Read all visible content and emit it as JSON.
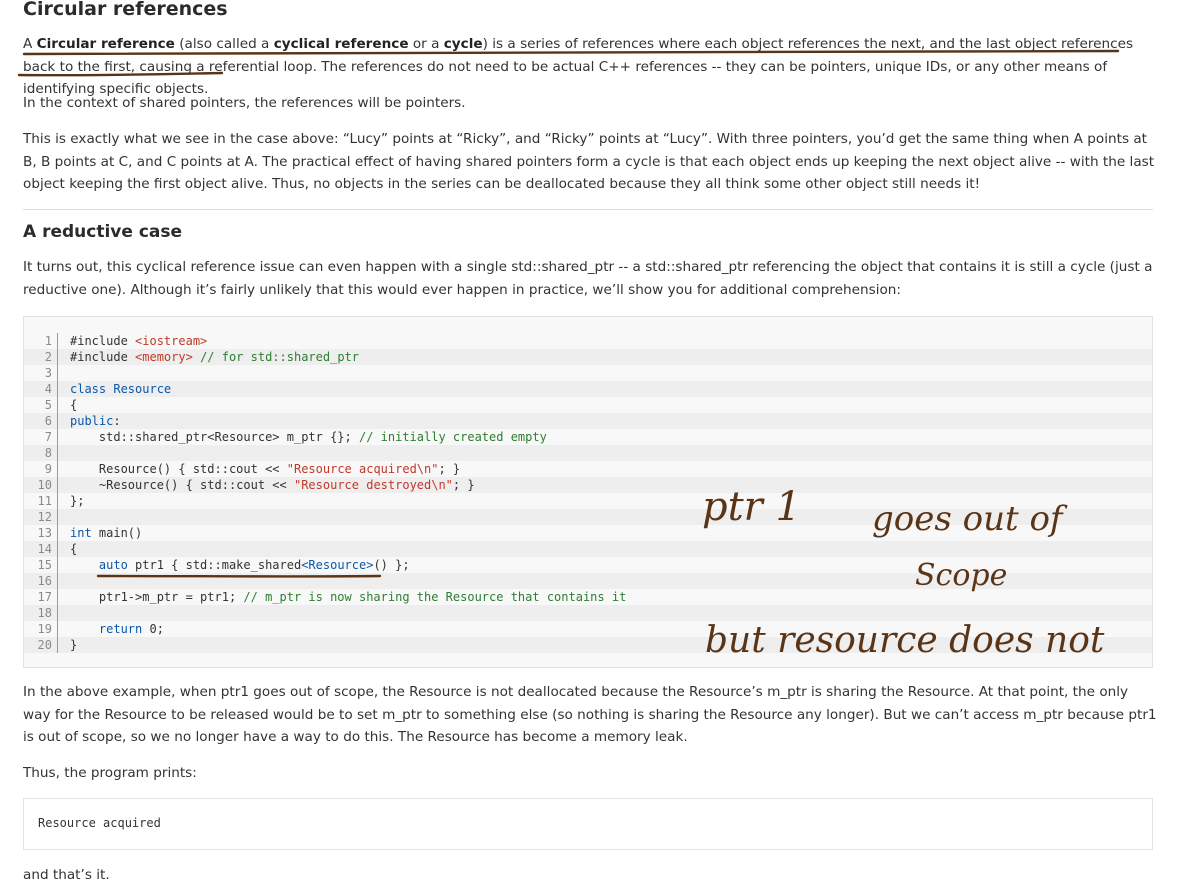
{
  "sections": {
    "circular_title": "Circular references",
    "p1": {
      "pre": "A ",
      "b1": "Circular reference",
      "m1": " (also called a ",
      "b2": "cyclical reference",
      "m2": " or a ",
      "b3": "cycle",
      "rest": ") is a series of references where each object references the next, and the last object references back to the first, causing a referential loop. The references do not need to be actual C++ references -- they can be pointers, unique IDs, or any other means of identifying specific objects."
    },
    "p2": "In the context of shared pointers, the references will be pointers.",
    "p3": "This is exactly what we see in the case above: “Lucy” points at “Ricky”, and “Ricky” points at “Lucy”. With three pointers, you’d get the same thing when A points at B, B points at C, and C points at A. The practical effect of having shared pointers form a cycle is that each object ends up keeping the next object alive -- with the last object keeping the first object alive. Thus, no objects in the series can be deallocated because they all think some other object still needs it!",
    "reductive_title": "A reductive case",
    "p4": "It turns out, this cyclical reference issue can even happen with a single std::shared_ptr -- a std::shared_ptr referencing the object that contains it is still a cycle (just a reductive one). Although it’s fairly unlikely that this would ever happen in practice, we’ll show you for additional comprehension:",
    "p5": "In the above example, when ptr1 goes out of scope, the Resource is not deallocated because the Resource’s m_ptr is sharing the Resource. At that point, the only way for the Resource to be released would be to set m_ptr to something else (so nothing is sharing the Resource any longer). But we can’t access m_ptr because ptr1 is out of scope, so we no longer have a way to do this. The Resource has become a memory leak.",
    "p6": "Thus, the program prints:",
    "output": "Resource acquired",
    "p7": "and that’s it."
  },
  "code": [
    {
      "n": "1",
      "html": "#include <span class='inc'>&lt;iostream&gt;</span>"
    },
    {
      "n": "2",
      "html": "#include <span class='inc'>&lt;memory&gt;</span> <span class='cm'>// for std::shared_ptr</span>"
    },
    {
      "n": "3",
      "html": ""
    },
    {
      "n": "4",
      "html": "<span class='kw'>class</span> <span class='kw'>Resource</span>"
    },
    {
      "n": "5",
      "html": "{"
    },
    {
      "n": "6",
      "html": "<span class='kw'>public</span>:"
    },
    {
      "n": "7",
      "html": "    std::shared_ptr&lt;Resource&gt; m_ptr {}; <span class='cm'>// initially created empty</span>"
    },
    {
      "n": "8",
      "html": ""
    },
    {
      "n": "9",
      "html": "    Resource() { std::cout &lt;&lt; <span class='st'>\"Resource acquired\\n\"</span>; }"
    },
    {
      "n": "10",
      "html": "    ~Resource() { std::cout &lt;&lt; <span class='st'>\"Resource destroyed\\n\"</span>; }"
    },
    {
      "n": "11",
      "html": "};"
    },
    {
      "n": "12",
      "html": ""
    },
    {
      "n": "13",
      "html": "<span class='kw'>int</span> main()"
    },
    {
      "n": "14",
      "html": "{"
    },
    {
      "n": "15",
      "html": "    <span class='kw'>auto</span> ptr1 { std::make_shared<span class='kw'>&lt;Resource&gt;</span>() };"
    },
    {
      "n": "16",
      "html": ""
    },
    {
      "n": "17",
      "html": "    ptr1-&gt;m_ptr = ptr1; <span class='cm'>// m_ptr is now sharing the Resource that contains it</span>"
    },
    {
      "n": "18",
      "html": ""
    },
    {
      "n": "19",
      "html": "    <span class='kw'>return</span> 0;"
    },
    {
      "n": "20",
      "html": "}"
    }
  ],
  "handwriting": {
    "line1a": "ptr 1",
    "line1b": "goes out of",
    "line2": "Scope",
    "line3": "but resource does not"
  },
  "colors": {
    "ink": "#5a3417",
    "keyword": "#0b57a8",
    "string": "#c0392b",
    "comment": "#2e7d32"
  }
}
